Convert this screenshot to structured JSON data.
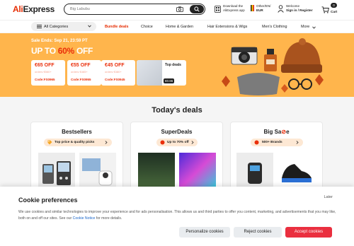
{
  "header": {
    "logo_part1": "Ali",
    "logo_part2": "Express",
    "search_placeholder": "Big Labubu",
    "download_line1": "Download the",
    "download_line2": "AliExpress app",
    "locale_line1": "Other/EN/",
    "locale_line2": "EUR",
    "welcome_line1": "Welcome",
    "welcome_line2": "Sign in / Register",
    "cart_count": "0",
    "cart_label": "Cart"
  },
  "nav": {
    "categories_label": "All Categories",
    "links": [
      "Bundle deals",
      "Choice",
      "Home & Garden",
      "Hair Extensions & Wigs",
      "Men's Clothing",
      "More"
    ]
  },
  "banner": {
    "sale_text": "Sale Ends: Sep 21, 23:59 PT",
    "upto_prefix": "UP TO ",
    "upto_pct": "60%",
    "upto_suffix": " OFF",
    "coupons": [
      {
        "amount": "€65 OFF",
        "orders": "orders €560+",
        "code": "Code:FS0965"
      },
      {
        "amount": "€55 OFF",
        "orders": "orders €465+",
        "code": "Code:FS0955"
      },
      {
        "amount": "€45 OFF",
        "orders": "orders €380+",
        "code": "Code:FS0945"
      }
    ],
    "topdeals_label": "Top deals",
    "topdeals_price": "€0.86"
  },
  "deals": {
    "title": "Today's deals",
    "cards": [
      {
        "title": "Bestsellers",
        "pill": "Top price & quality picks"
      },
      {
        "title": "SuperDeals",
        "pill": "Up to 70% off"
      },
      {
        "title_prefix": "Big Sa",
        "title_suffix": "e",
        "pill": "500+ Brands"
      }
    ]
  },
  "cookie": {
    "title": "Cookie preferences",
    "later": "Later",
    "text_before": "We use cookies and similar technologies to improve your experience and for ads personalisation. This allows us and third parties to offer you content, marketing, and advertisements that you may like, both on and off our sites. See our ",
    "link": "Cookie Notice",
    "text_after": " for more details.",
    "personalize": "Personalize cookies",
    "reject": "Reject cookies",
    "accept": "Accept cookies"
  },
  "colors": {
    "brand_red": "#e62e04",
    "banner_orange": "#ffb54c",
    "accept_red": "#ea2f3f"
  }
}
